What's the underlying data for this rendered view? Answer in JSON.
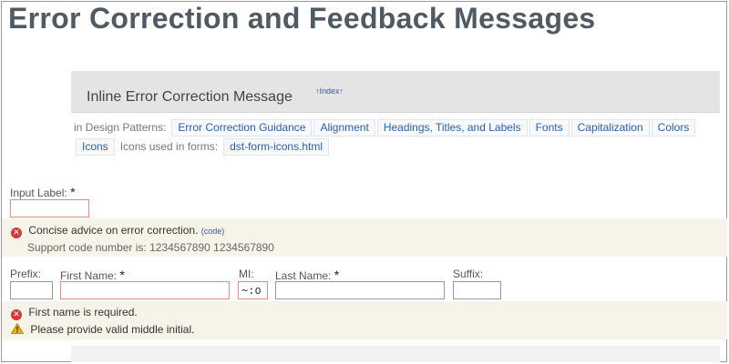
{
  "page": {
    "title": "Error Correction and Feedback Messages"
  },
  "section": {
    "title": "Inline Error Correction Message",
    "index_link": "↑Index↑"
  },
  "design_patterns": {
    "label": "in Design Patterns:",
    "links": [
      "Error Correction Guidance",
      "Alignment",
      "Headings, Titles, and Labels",
      "Fonts",
      "Capitalization",
      "Colors",
      "Icons"
    ],
    "icons_label": "Icons used in forms:",
    "icons_link": "dst-form-icons.html"
  },
  "form1": {
    "input_label": "Input Label:",
    "required_mark": "*",
    "input_value": "",
    "error_message": "Concise advice on error correction.",
    "code_link": "(code)",
    "support_text": "Support code number is: 1234567890 1234567890"
  },
  "form2": {
    "prefix_label": "Prefix:",
    "first_name_label": "First Name:",
    "first_name_required": "*",
    "mi_label": "MI:",
    "last_name_label": "Last Name:",
    "last_name_required": "*",
    "suffix_label": "Suffix:",
    "prefix_value": "",
    "first_name_value": "",
    "mi_value": "~:o",
    "last_name_value": "",
    "suffix_value": "",
    "error_message": "First name is required.",
    "warning_message": "Please provide valid middle initial."
  },
  "colors": {
    "error": "#d43838",
    "warning": "#e8b21c",
    "link": "#2d5ea5",
    "message_background": "#f6f4e8"
  }
}
